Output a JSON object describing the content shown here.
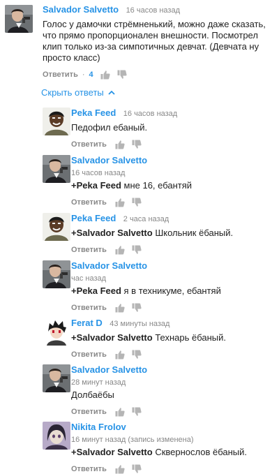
{
  "colors": {
    "link": "#2793e6",
    "muted": "#888888",
    "text": "#222222"
  },
  "top_comment": {
    "author": "Salvador Salvetto",
    "time": "16 часов назад",
    "text": "Голос у дамочки стрёмненький, можно даже сказать, что прямо пропорционален внешности. Посмотрел клип только из-за симпотичных девчат. (Девчата ну просто класс)",
    "reply_label": "Ответить",
    "separator": "·",
    "likes": "4"
  },
  "hide_replies_label": "Скрыть ответы",
  "replies": [
    {
      "author": "Peka Feed",
      "time": "16 часов назад",
      "mention": "",
      "text": "Педофил ебаный.",
      "reply_label": "Ответить"
    },
    {
      "author": "Salvador Salvetto",
      "time": "16 часов назад",
      "mention": "+Peka Feed",
      "text": " мне 16, ебантяй",
      "reply_label": "Ответить"
    },
    {
      "author": "Peka Feed",
      "time": "2 часа назад",
      "mention": "+Salvador Salvetto",
      "text": " Школьник ёбаный.",
      "reply_label": "Ответить"
    },
    {
      "author": "Salvador Salvetto",
      "time": "час назад",
      "mention": "+Peka Feed",
      "text": " я в техникуме, ебантяй",
      "reply_label": "Ответить"
    },
    {
      "author": "Ferat D",
      "time": "43 минуты назад",
      "mention": "+Salvador Salvetto",
      "text": " Технарь ёбаный.",
      "reply_label": "Ответить"
    },
    {
      "author": "Salvador Salvetto",
      "time": "28 минут назад",
      "mention": "",
      "text": "Долбаёбы",
      "reply_label": "Ответить"
    },
    {
      "author": "Nikita Frolov",
      "time": "16 минут назад (запись изменена)",
      "mention": "+Salvador Salvetto",
      "text": " Сквернослов ёбаный.",
      "reply_label": "Ответить"
    }
  ]
}
